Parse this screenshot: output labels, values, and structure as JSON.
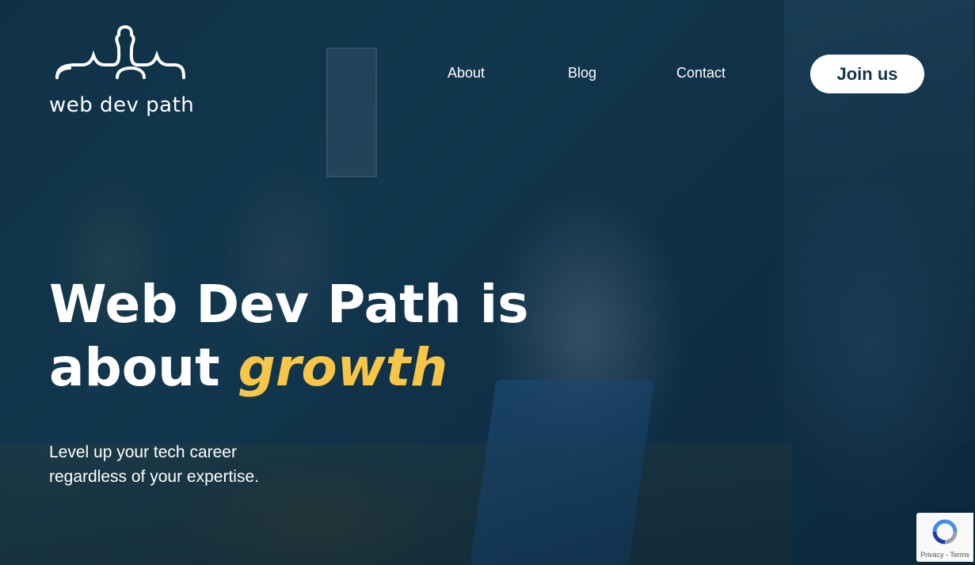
{
  "logo": {
    "text": "web dev path",
    "icon": "curly-brace-path-logo"
  },
  "nav": {
    "items": [
      {
        "label": "About"
      },
      {
        "label": "Blog"
      },
      {
        "label": "Contact"
      }
    ],
    "cta_label": "Join us"
  },
  "hero": {
    "headline_line1": "Web Dev Path is",
    "headline_line2_prefix": "about ",
    "headline_accent": "growth",
    "subheading": "Level up your tech career regardless of your expertise."
  },
  "recaptcha": {
    "privacy": "Privacy",
    "separator": " - ",
    "terms": "Terms",
    "icon": "recaptcha-icon"
  },
  "colors": {
    "accent": "#f7c548",
    "button_text": "#14344a",
    "overlay": "#13374d"
  }
}
